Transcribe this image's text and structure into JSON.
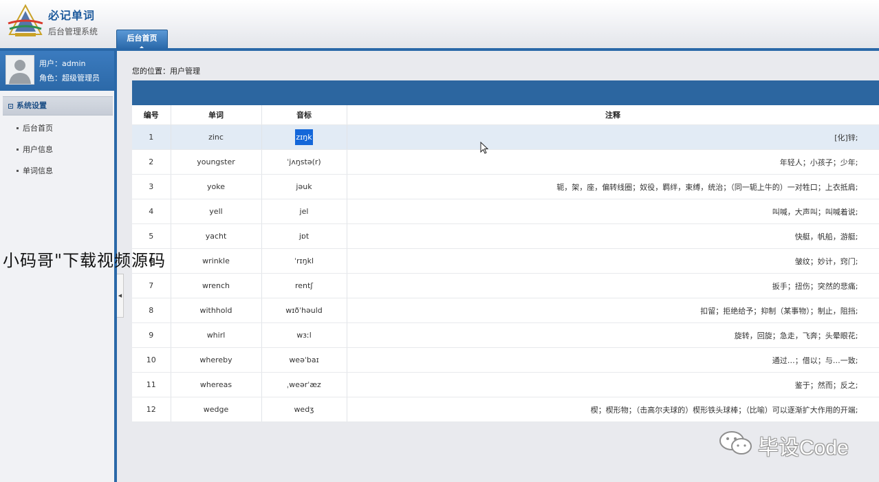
{
  "header": {
    "app_title": "必记单词",
    "app_subtitle": "后台管理系统",
    "active_tab": "后台首页"
  },
  "sidebar": {
    "user_line": "用户：admin",
    "role_line": "角色：超级管理员",
    "section_title": "系统设置",
    "items": [
      {
        "label": "后台首页"
      },
      {
        "label": "用户信息"
      },
      {
        "label": "单词信息"
      }
    ]
  },
  "main": {
    "breadcrumb": "您的位置：用户管理",
    "columns": [
      "编号",
      "单词",
      "音标",
      "注释"
    ],
    "rows": [
      {
        "id": "1",
        "word": "zinc",
        "phonetic": "zɪŋk",
        "note": "[化]锌;"
      },
      {
        "id": "2",
        "word": "youngster",
        "phonetic": "ˈjʌŋstə(r)",
        "note": "年轻人；小孩子；少年;"
      },
      {
        "id": "3",
        "word": "yoke",
        "phonetic": "jəuk",
        "note": "轭，架，座，偏转线圈；奴役，羁绊，束缚，统治；（同一轭上牛的）一对牲口；上衣抵肩;"
      },
      {
        "id": "4",
        "word": "yell",
        "phonetic": "jel",
        "note": "叫喊，大声叫；叫喊着说;"
      },
      {
        "id": "5",
        "word": "yacht",
        "phonetic": "jɒt",
        "note": "快艇，帆船，游艇;"
      },
      {
        "id": "6",
        "word": "wrinkle",
        "phonetic": "ˈrɪŋkl",
        "note": "皱纹；妙计，窍门;"
      },
      {
        "id": "7",
        "word": "wrench",
        "phonetic": "rentʃ",
        "note": "扳手；扭伤；突然的悲痛;"
      },
      {
        "id": "8",
        "word": "withhold",
        "phonetic": "wɪðˈhəuld",
        "note": "扣留；拒绝给予；抑制（某事物）；制止，阻挡;"
      },
      {
        "id": "9",
        "word": "whirl",
        "phonetic": "wɜːl",
        "note": "旋转，回旋；急走，飞奔；头晕眼花;"
      },
      {
        "id": "10",
        "word": "whereby",
        "phonetic": "weəˈbaɪ",
        "note": "通过…；借以；与…一致;"
      },
      {
        "id": "11",
        "word": "whereas",
        "phonetic": "ˌweərˈæz",
        "note": "鉴于；然而；反之;"
      },
      {
        "id": "12",
        "word": "wedge",
        "phonetic": "wedʒ",
        "note": "楔；楔形物；（击高尔夫球的）楔形铁头球棒；（比喻）可以逐渐扩大作用的开端;"
      }
    ]
  },
  "overlay": {
    "left_watermark": "小码哥\"下载视频源码",
    "right_watermark": "毕设Code"
  },
  "colors": {
    "primary_blue": "#2a68a8",
    "header_bar": "#2c66a0",
    "selected_row": "#e2ebf5",
    "text_selection": "#1467d9"
  }
}
